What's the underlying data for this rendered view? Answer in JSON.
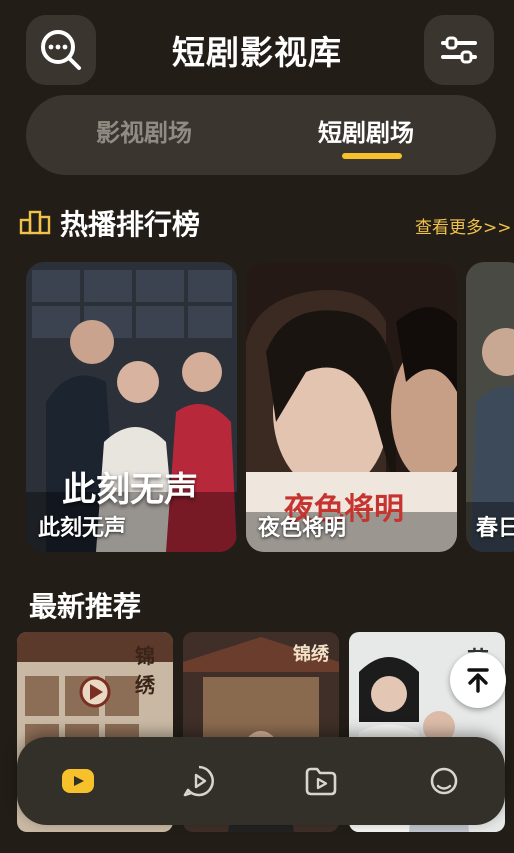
{
  "header": {
    "title": "短剧影视库",
    "search_icon": "search-chat-icon",
    "filter_icon": "sliders-icon"
  },
  "tabs": [
    {
      "label": "影视剧场",
      "active": false
    },
    {
      "label": "短剧剧场",
      "active": true
    }
  ],
  "hot_section": {
    "title": "热播排行榜",
    "icon": "ranking-podium-icon",
    "more_label": "查看更多>>",
    "items": [
      {
        "title": "此刻无声",
        "poster_text": "此刻无声"
      },
      {
        "title": "夜色将明",
        "poster_text": "夜色将明"
      },
      {
        "title": "春日"
      }
    ]
  },
  "recommend_section": {
    "title": "最新推荐",
    "items": [
      {
        "poster_text": "锦绣"
      },
      {
        "poster_text": "锦绣"
      },
      {
        "poster_text": "花"
      }
    ]
  },
  "bottom_nav": [
    {
      "icon": "video-icon",
      "active": true
    },
    {
      "icon": "play-bubble-icon",
      "active": false
    },
    {
      "icon": "folder-play-icon",
      "active": false
    },
    {
      "icon": "profile-icon",
      "active": false
    }
  ],
  "colors": {
    "background": "#221e17",
    "surface": "#3a362f",
    "accent": "#f6c12a",
    "link": "#f0c14b"
  }
}
